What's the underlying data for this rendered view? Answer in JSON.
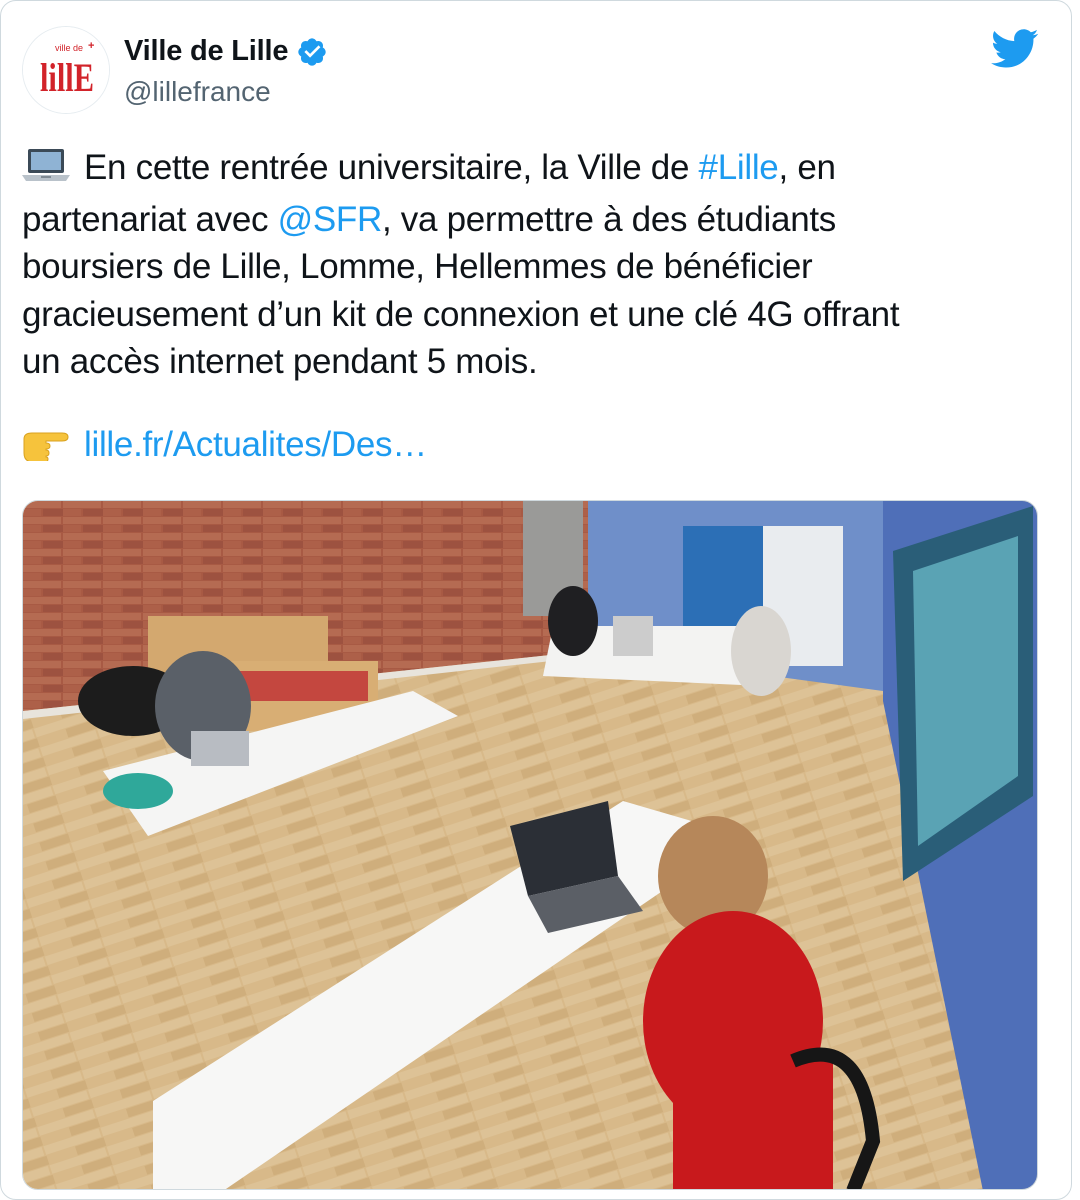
{
  "tweet": {
    "author": {
      "display_name": "Ville de Lille",
      "handle": "@lillefrance",
      "verified": true,
      "logo_small_text": "ville de",
      "logo_text": "lillE"
    },
    "text_lines": [
      {
        "before": "En cette rentrée universitaire, la Ville de ",
        "link": "#Lille",
        "after": ", en"
      },
      {
        "before": "partenariat avec ",
        "link": "@SFR",
        "after": ", va permettre à des étudiants"
      },
      {
        "before": "boursiers de Lille, Lomme, Hellemmes de bénéficier",
        "link": "",
        "after": ""
      },
      {
        "before": "gracieusement d’un kit de connexion et une clé 4G offrant",
        "link": "",
        "after": ""
      },
      {
        "before": "un accès internet pendant 5 mois.",
        "link": "",
        "after": ""
      }
    ],
    "leading_emoji": "laptop-icon",
    "url_emoji": "pointing-hand-icon",
    "url_text": "lille.fr/Actualites/Des…",
    "media_description_icon": "photo-of-students-working-on-laptops"
  },
  "colors": {
    "link": "#1d9bf0",
    "text": "#0f1419",
    "secondary": "#536471",
    "twitter_blue": "#1d9bf0",
    "lille_red": "#d2232a"
  }
}
